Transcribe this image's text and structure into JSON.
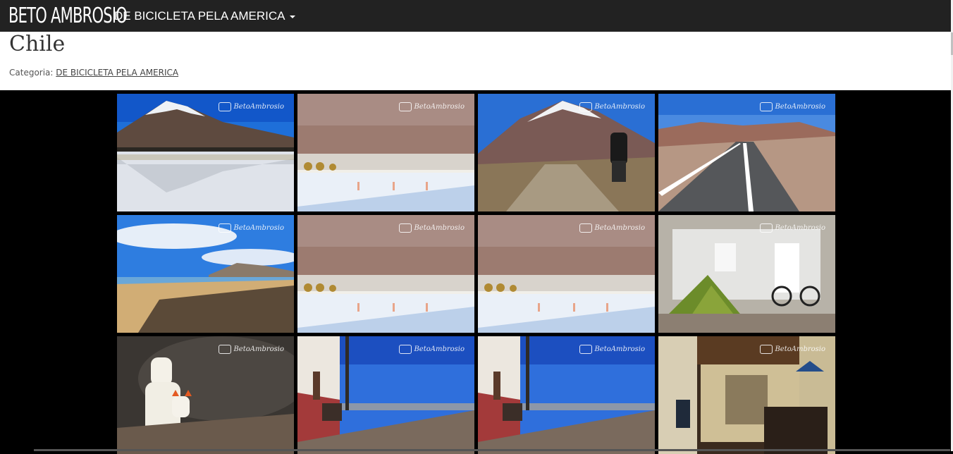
{
  "navbar": {
    "brand": "BETO AMBROSIO",
    "menu_label": "DE BICICLETA PELA AMERICA"
  },
  "page": {
    "title": "Chile",
    "category_prefix": "Categoria:",
    "category_link": "DE BICICLETA PELA AMERICA"
  },
  "gallery": {
    "watermark": "BetoAmbrosio",
    "photos": [
      {
        "name": "photo-volcano-lake-reflection",
        "scene": "volcano-lake"
      },
      {
        "name": "photo-flamingos-lagoon",
        "scene": "flamingos"
      },
      {
        "name": "photo-cyclist-dirt-road",
        "scene": "cyclist"
      },
      {
        "name": "photo-desert-highway",
        "scene": "highway"
      },
      {
        "name": "photo-beach-coast",
        "scene": "beach"
      },
      {
        "name": "photo-flamingos-lagoon-2",
        "scene": "flamingos"
      },
      {
        "name": "photo-flamingos-lagoon-3",
        "scene": "flamingos"
      },
      {
        "name": "photo-tent-in-ruins",
        "scene": "tent"
      },
      {
        "name": "photo-llamas-rocks",
        "scene": "llamas"
      },
      {
        "name": "photo-railway-station",
        "scene": "railway"
      },
      {
        "name": "photo-railway-station-2",
        "scene": "railway"
      },
      {
        "name": "photo-church-interior",
        "scene": "church"
      }
    ]
  }
}
